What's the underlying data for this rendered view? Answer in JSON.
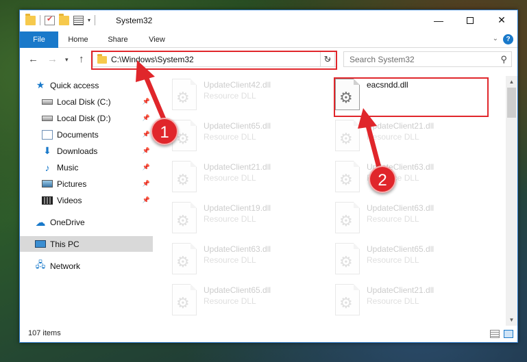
{
  "window": {
    "title": "System32",
    "help_label": "?"
  },
  "ribbon": {
    "tabs": [
      {
        "label": "File"
      },
      {
        "label": "Home"
      },
      {
        "label": "Share"
      },
      {
        "label": "View"
      }
    ]
  },
  "address_bar": {
    "path": "C:\\Windows\\System32"
  },
  "search": {
    "placeholder": "Search System32"
  },
  "nav_pane": {
    "items": [
      {
        "label": "Quick access",
        "icon": "star-icon"
      },
      {
        "label": "Local Disk (C:)",
        "icon": "drive-icon",
        "pinned": true
      },
      {
        "label": "Local Disk (D:)",
        "icon": "drive-icon",
        "pinned": true
      },
      {
        "label": "Documents",
        "icon": "documents-icon",
        "pinned": true
      },
      {
        "label": "Downloads",
        "icon": "downloads-icon",
        "pinned": true
      },
      {
        "label": "Music",
        "icon": "music-icon",
        "pinned": true
      },
      {
        "label": "Pictures",
        "icon": "pictures-icon",
        "pinned": true
      },
      {
        "label": "Videos",
        "icon": "videos-icon",
        "pinned": true
      },
      {
        "label": "OneDrive",
        "icon": "onedrive-icon"
      },
      {
        "label": "This PC",
        "icon": "this-pc-icon",
        "selected": true
      },
      {
        "label": "Network",
        "icon": "network-icon"
      }
    ]
  },
  "files": [
    {
      "name": "UpdateClient42.dll",
      "type": "Resource DLL"
    },
    {
      "name": "eacsndd.dll",
      "type": ""
    },
    {
      "name": "UpdateClient65.dll",
      "type": "Resource DLL"
    },
    {
      "name": "UpdateClient21.dll",
      "type": "Resource DLL"
    },
    {
      "name": "UpdateClient21.dll",
      "type": "Resource DLL"
    },
    {
      "name": "UpdateClient63.dll",
      "type": "Resource DLL"
    },
    {
      "name": "UpdateClient19.dll",
      "type": "Resource DLL"
    },
    {
      "name": "UpdateClient63.dll",
      "type": "Resource DLL"
    },
    {
      "name": "UpdateClient63.dll",
      "type": "Resource DLL"
    },
    {
      "name": "UpdateClient65.dll",
      "type": "Resource DLL"
    },
    {
      "name": "UpdateClient65.dll",
      "type": "Resource DLL"
    },
    {
      "name": "UpdateClient21.dll",
      "type": "Resource DLL"
    }
  ],
  "status_bar": {
    "item_count": "107 items"
  },
  "annotations": {
    "step1": "1",
    "step2": "2",
    "highlight_color": "#e0262b"
  },
  "colors": {
    "accent": "#1979ca"
  }
}
